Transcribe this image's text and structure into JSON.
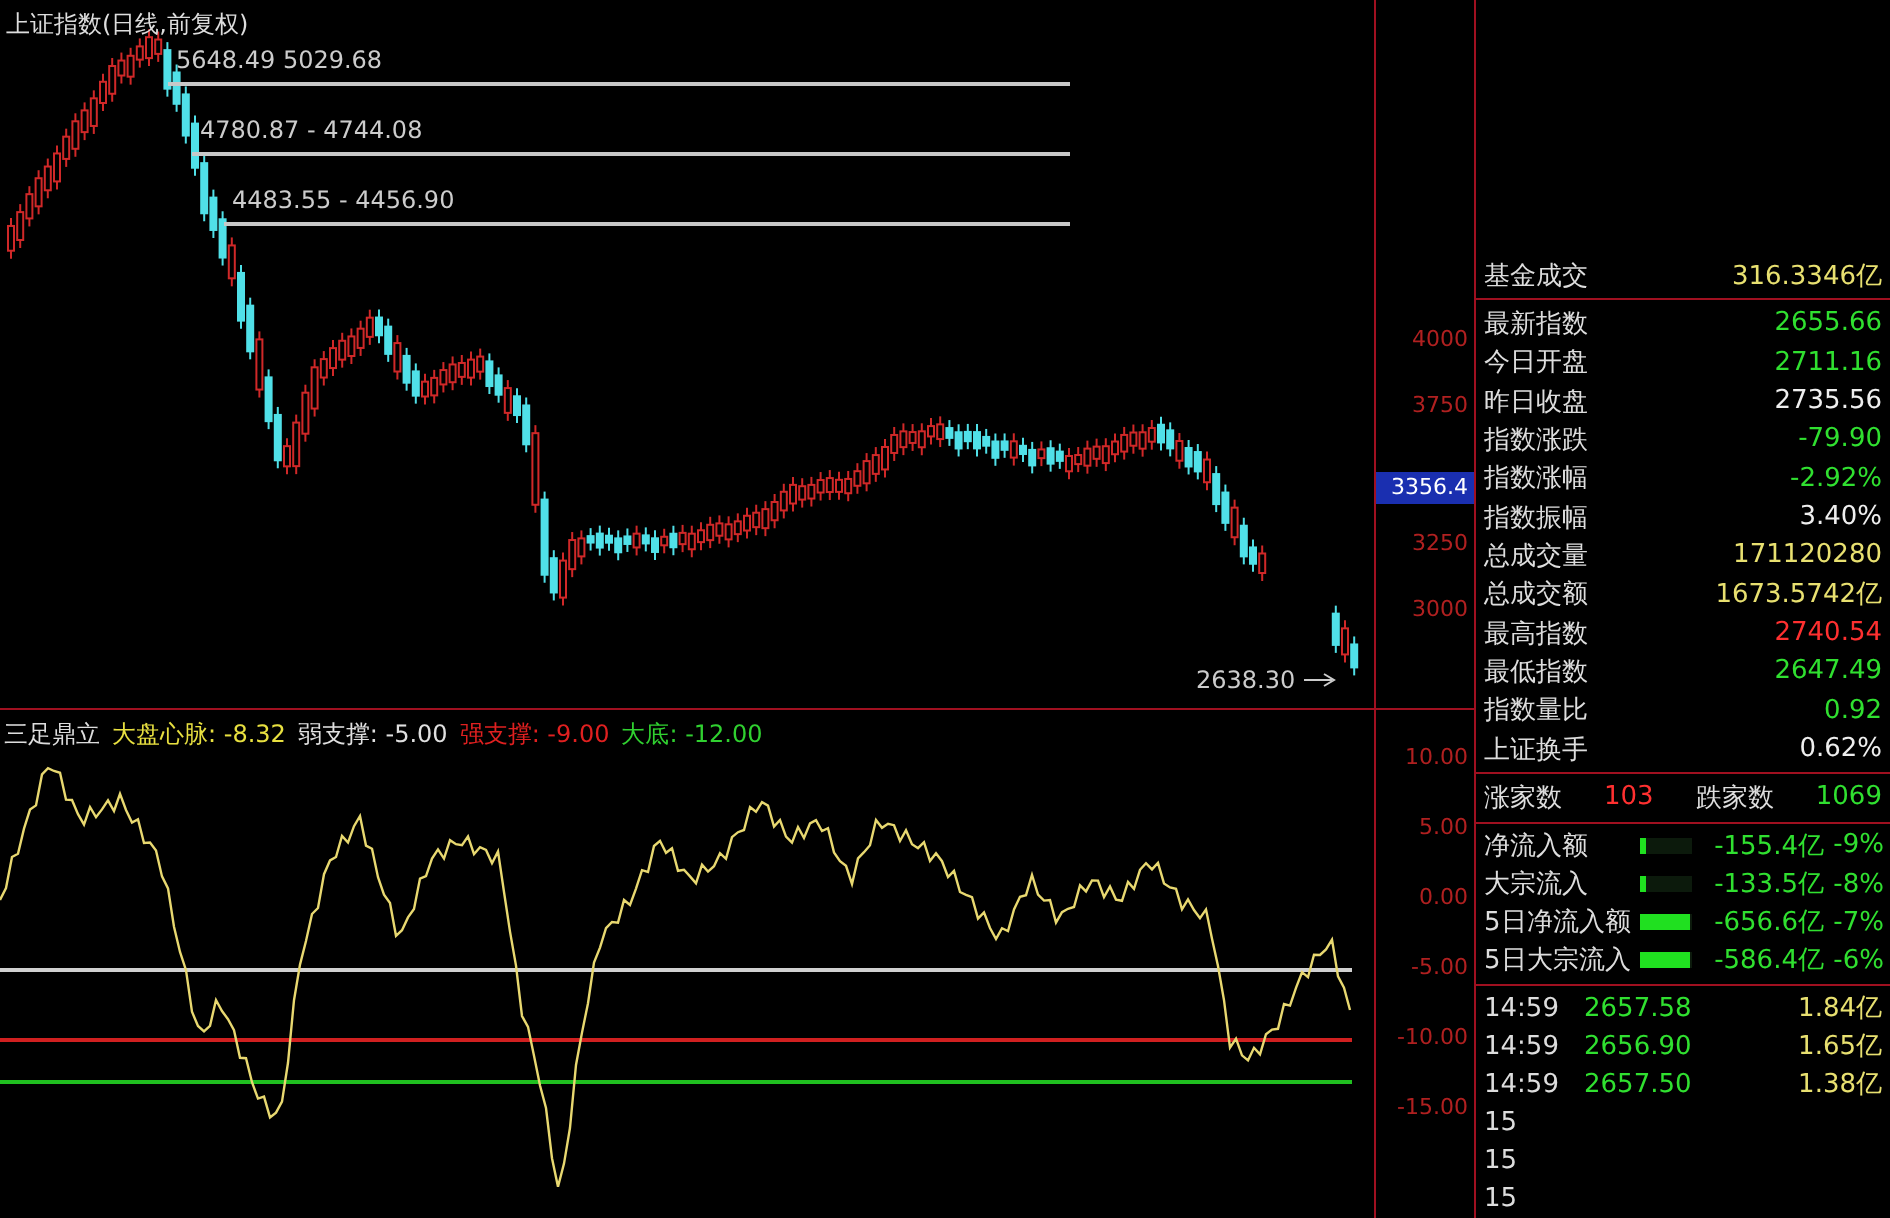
{
  "title": "上证指数(日线,前复权)",
  "price_levels": [
    {
      "label": "5648.49 5029.68"
    },
    {
      "label": "4780.87 - 4744.08"
    },
    {
      "label": "4483.55 - 4456.90"
    }
  ],
  "last_price_label": "2638.30",
  "price_axis": {
    "ticks": [
      "4000",
      "3750",
      "3250",
      "3000"
    ],
    "current": "3356.4"
  },
  "indicator": {
    "name": "三足鼎立",
    "values": [
      {
        "label": "大盘心脉:",
        "value": "-8.32",
        "color": "#e8e040"
      },
      {
        "label": "弱支撑:",
        "value": "-5.00",
        "color": "#e0e0e0"
      },
      {
        "label": "强支撑:",
        "value": "-9.00",
        "color": "#e02020"
      },
      {
        "label": "大底:",
        "value": "-12.00",
        "color": "#30d030"
      }
    ]
  },
  "indicator_axis": [
    "10.00",
    "5.00",
    "0.00",
    "-5.00",
    "-10.00",
    "-15.00"
  ],
  "quote_rows": [
    {
      "label": "基金成交",
      "value": "316.3346亿",
      "color": "#e8e070"
    },
    {
      "label": "最新指数",
      "value": "2655.66",
      "color": "#30e030"
    },
    {
      "label": "今日开盘",
      "value": "2711.16",
      "color": "#30e030"
    },
    {
      "label": "昨日收盘",
      "value": "2735.56",
      "color": "#eeeeee"
    },
    {
      "label": "指数涨跌",
      "value": "-79.90",
      "color": "#30e030"
    },
    {
      "label": "指数涨幅",
      "value": "-2.92%",
      "color": "#30e030"
    },
    {
      "label": "指数振幅",
      "value": "3.40%",
      "color": "#eeeeee"
    },
    {
      "label": "总成交量",
      "value": "171120280",
      "color": "#e8e070"
    },
    {
      "label": "总成交额",
      "value": "1673.5742亿",
      "color": "#e8e070"
    },
    {
      "label": "最高指数",
      "value": "2740.54",
      "color": "#ff3030"
    },
    {
      "label": "最低指数",
      "value": "2647.49",
      "color": "#30e030"
    },
    {
      "label": "指数量比",
      "value": "0.92",
      "color": "#30e030"
    },
    {
      "label": "上证换手",
      "value": "0.62%",
      "color": "#eeeeee"
    }
  ],
  "breadth": {
    "up_label": "涨家数",
    "up_count": "103",
    "down_label": "跌家数",
    "down_count": "1069"
  },
  "flows": [
    {
      "label": "净流入额",
      "level": 0.12,
      "value": "-155.4亿",
      "pct": "-9%"
    },
    {
      "label": "大宗流入",
      "level": 0.12,
      "value": "-133.5亿",
      "pct": "-8%"
    },
    {
      "label": "5日净流入额",
      "level": 0.95,
      "value": "-656.6亿",
      "pct": "-7%"
    },
    {
      "label": "5日大宗流入",
      "level": 0.95,
      "value": "-586.4亿",
      "pct": "-6%"
    }
  ],
  "ticks": [
    {
      "time": "14:59",
      "price": "2657.58",
      "amount": "1.84亿"
    },
    {
      "time": "14:59",
      "price": "2656.90",
      "amount": "1.65亿"
    },
    {
      "time": "14:59",
      "price": "2657.50",
      "amount": "1.38亿"
    },
    {
      "time": "15"
    },
    {
      "time": "15"
    },
    {
      "time": "15"
    }
  ]
}
